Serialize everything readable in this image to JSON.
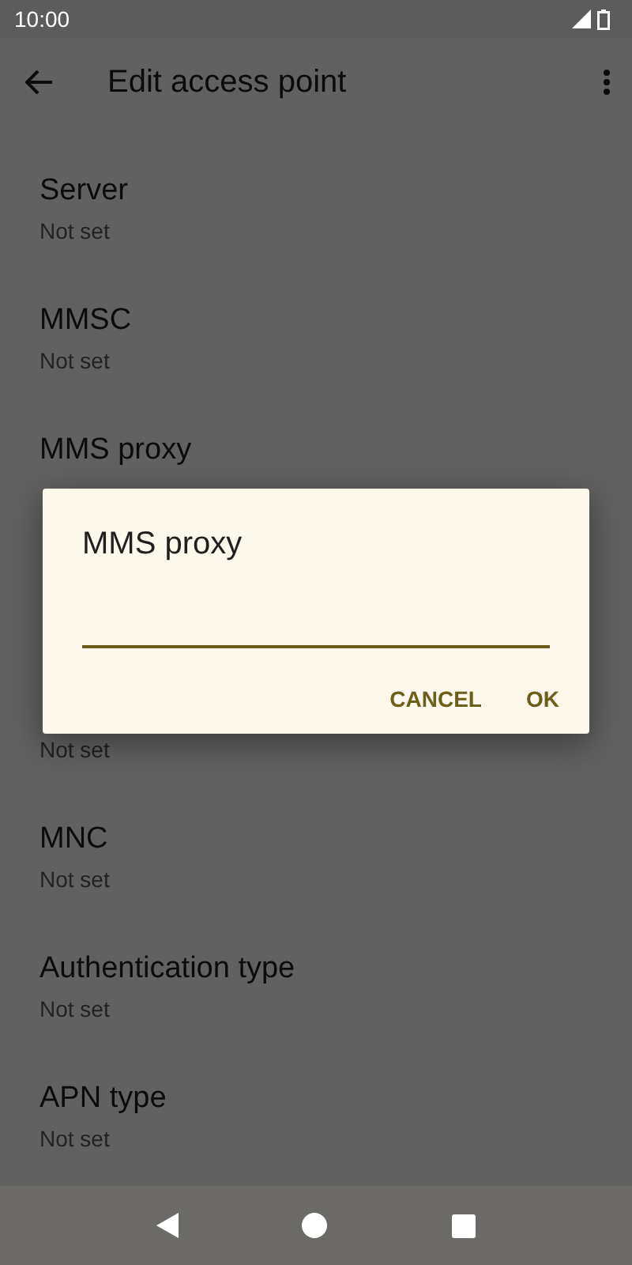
{
  "status_bar": {
    "time": "10:00"
  },
  "toolbar": {
    "title": "Edit access point"
  },
  "settings": [
    {
      "title": "Server",
      "summary": "Not set"
    },
    {
      "title": "MMSC",
      "summary": "Not set"
    },
    {
      "title": "MMS proxy"
    },
    {
      "summary": "Not set"
    },
    {
      "title": "MNC",
      "summary": "Not set"
    },
    {
      "title": "Authentication type",
      "summary": "Not set"
    },
    {
      "title": "APN type",
      "summary": "Not set"
    }
  ],
  "dialog": {
    "title": "MMS proxy",
    "buttons": [
      "CANCEL",
      "OK"
    ]
  }
}
